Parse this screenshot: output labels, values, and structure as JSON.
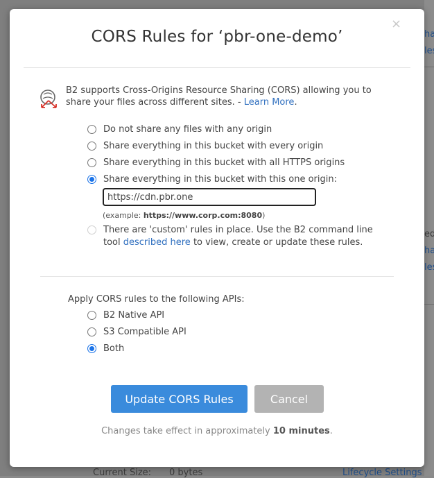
{
  "background": {
    "link_fragments": [
      "hap",
      "les",
      "hap",
      "les"
    ],
    "text_fragment": "ed",
    "current_size_label": "Current Size:",
    "current_size_value": "0 bytes",
    "lifecycle_link": "Lifecycle Settings"
  },
  "modal": {
    "close_label": "×",
    "title": "CORS Rules for ‘pbr-one-demo’",
    "intro_text": "B2 supports Cross-Origins Resource Sharing (CORS) allowing you to share your files across different sites. - ",
    "learn_more": "Learn More",
    "intro_period": ".",
    "sharing_options": [
      {
        "label": "Do not share any files with any origin",
        "checked": false
      },
      {
        "label": "Share everything in this bucket with every origin",
        "checked": false
      },
      {
        "label": "Share everything in this bucket with all HTTPS origins",
        "checked": false
      },
      {
        "label": "Share everything in this bucket with this one origin:",
        "checked": true
      }
    ],
    "origin_value": "https://cdn.pbr.one",
    "example_prefix": "(example: ",
    "example_value": "https://www.corp.com:8080",
    "example_suffix": ")",
    "custom_text_1": "There are 'custom' rules in place. Use the B2 command line tool ",
    "custom_link": "described here",
    "custom_text_2": " to view, create or update these rules.",
    "apis_label": "Apply CORS rules to the following APIs:",
    "api_options": [
      {
        "label": "B2 Native API",
        "checked": false
      },
      {
        "label": "S3 Compatible API",
        "checked": false
      },
      {
        "label": "Both",
        "checked": true
      }
    ],
    "update_button": "Update CORS Rules",
    "cancel_button": "Cancel",
    "footer_prefix": "Changes take effect in approximately ",
    "footer_bold": "10 minutes",
    "footer_suffix": "."
  },
  "colors": {
    "primary": "#3a8bdc",
    "cancel": "#b3b3b3",
    "link": "#2f6fbf",
    "radio_checked": "#1a73e8"
  },
  "icons": {
    "intro": "cors-sharing-icon",
    "close": "close-icon"
  }
}
